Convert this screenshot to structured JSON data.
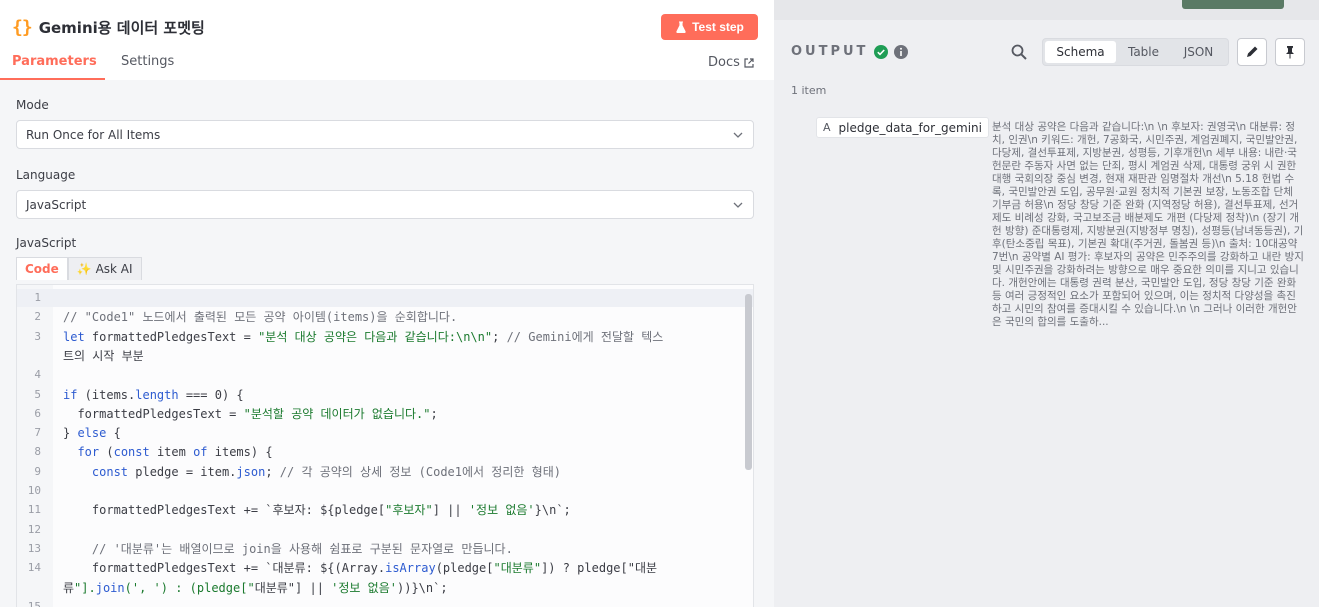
{
  "node": {
    "title": "Gemini용 데이터 포멧팅",
    "test_step_label": "Test step",
    "tabs": [
      "Parameters",
      "Settings"
    ],
    "docs_label": "Docs"
  },
  "mode": {
    "label": "Mode",
    "value": "Run Once for All Items"
  },
  "language": {
    "label": "Language",
    "value": "JavaScript"
  },
  "code_section": {
    "label": "JavaScript",
    "tabs": [
      "Code",
      "Ask AI"
    ],
    "ask_ai_glyph": "✨",
    "line_numbers": [
      "1",
      "2",
      "3",
      "",
      "4",
      "5",
      "6",
      "7",
      "8",
      "9",
      "10",
      "11",
      "12",
      "13",
      "14",
      "",
      "15"
    ],
    "lines": [
      "",
      "// \"Code1\" 노드에서 출력된 모든 공약 아이템(items)을 순회합니다.",
      "let formattedPledgesText = \"분석 대상 공약은 다음과 같습니다:\\n\\n\"; // Gemini에게 전달할 텍스",
      "트의 시작 부분",
      "",
      "if (items.length === 0) {",
      "  formattedPledgesText = \"분석할 공약 데이터가 없습니다.\";",
      "} else {",
      "  for (const item of items) {",
      "    const pledge = item.json; // 각 공약의 상세 정보 (Code1에서 정리한 형태)",
      "",
      "    formattedPledgesText += `후보자: ${pledge[\"후보자\"] || '정보 없음'}\\n`;",
      "",
      "    // '대분류'는 배열이므로 join을 사용해 쉼표로 구분된 문자열로 만듭니다.",
      "    formattedPledgesText += `대분류: ${(Array.isArray(pledge[\"대분류\"]) ? pledge[\"대분",
      "류\"].join(', ') : (pledge[\"대분류\"] || '정보 없음'))}\\n`;",
      ""
    ]
  },
  "output": {
    "title": "OUTPUT",
    "views": [
      "Schema",
      "Table",
      "JSON"
    ],
    "active_view": "Schema",
    "item_count": "1 item",
    "schema": {
      "type_glyph": "A",
      "key": "pledge_data_for_gemini",
      "value": "분석 대상 공약은 다음과 같습니다:\\n \\n 후보자: 권영국\\n 대분류: 정치, 인권\\n 키워드: 개헌, 7공화국, 시민주권, 계엄권폐지, 국민발안권, 다당제, 결선투표제, 지방분권, 성평등, 기후개헌\\n 세부 내용: 내란·국헌문란 주동자 사면 없는 단죄, 평시 계엄권 삭제, 대통령 궁위 시 권한대행 국회의장 중심 변경, 현재 재판관 임명절차 개선\\n 5.18 헌법 수록, 국민발안권 도입, 공무원·교원 정치적 기본권 보장, 노동조합 단체 기부금 허용\\n 정당 창당 기준 완화 (지역정당 허용), 결선투표제, 선거제도 비례성 강화, 국고보조금 배분제도 개편 (다당제 정착)\\n (장기 개헌 방향) 준대통령제, 지방분권(지방정부 명칭), 성평등(남녀동등권), 기후(탄소중립 목표), 기본권 확대(주거권, 돌봄권 등)\\n 출처: 10대공약 7번\\n 공약별 AI 평가: 후보자의 공약은 민주주의를 강화하고 내란 방지 및 시민주권을 강화하려는 방향으로 매우 중요한 의미를 지니고 있습니다. 개헌안에는 대통령 권력 분산, 국민발안 도입, 정당 창당 기준 완화 등 여러 긍정적인 요소가 포함되어 있으며, 이는 정치적 다양성을 촉진하고 시민의 참여를 증대시킬 수 있습니다.\\n \\n 그러나 이러한 개헌안은 국민의 합의를 도출하..."
    }
  },
  "colors": {
    "accent": "#ff6d5a",
    "success": "#1f9d55",
    "braces": "#ff9b21"
  }
}
